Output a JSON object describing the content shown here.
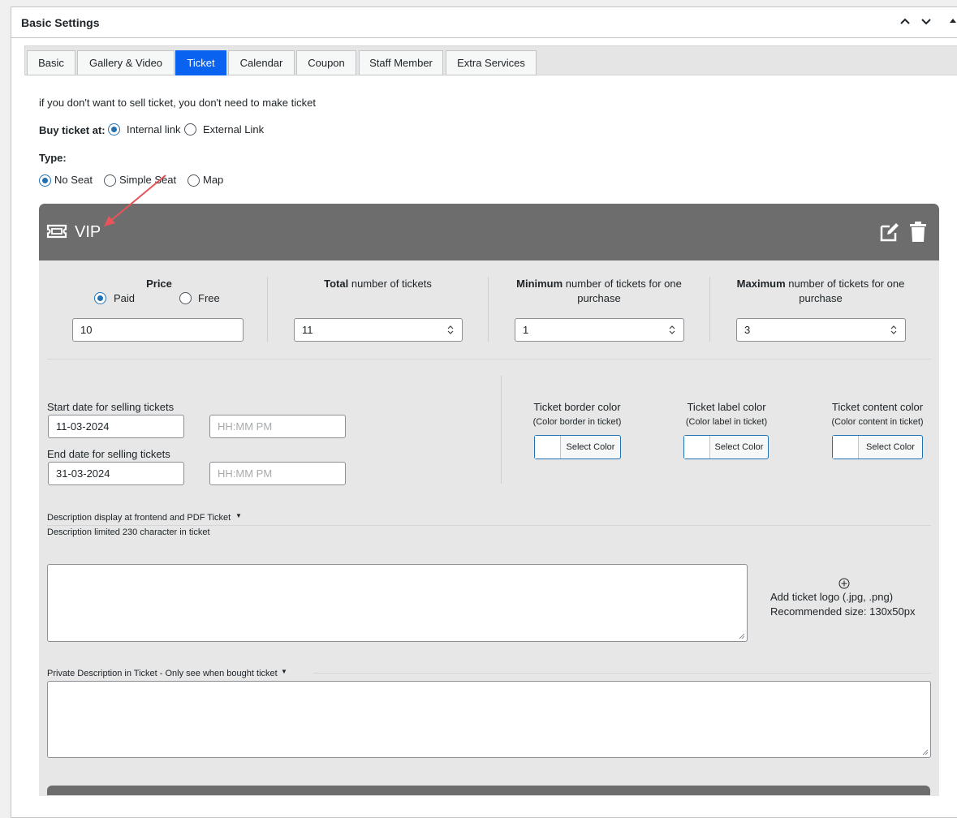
{
  "panel": {
    "title": "Basic Settings"
  },
  "tabs": [
    {
      "label": "Basic"
    },
    {
      "label": "Gallery & Video"
    },
    {
      "label": "Ticket"
    },
    {
      "label": "Calendar"
    },
    {
      "label": "Coupon"
    },
    {
      "label": "Staff Member"
    },
    {
      "label": "Extra Services"
    }
  ],
  "notice": "if you don't want to sell ticket, you don't need to make ticket",
  "buy_ticket": {
    "label": "Buy ticket at:",
    "options": [
      "Internal link",
      "External Link"
    ],
    "selected": "Internal link"
  },
  "type": {
    "label": "Type:",
    "options": [
      "No Seat",
      "Simple Seat",
      "Map"
    ],
    "selected": "No Seat"
  },
  "ticket": {
    "name": "VIP",
    "price": {
      "label": "Price",
      "options": [
        "Paid",
        "Free"
      ],
      "selected": "Paid",
      "value": "10"
    },
    "total": {
      "bold": "Total",
      "rest": " number of tickets",
      "value": "11"
    },
    "minimum": {
      "bold": "Minimum",
      "rest": " number of tickets for one purchase",
      "value": "1"
    },
    "maximum": {
      "bold": "Maximum",
      "rest": " number of tickets for one purchase",
      "value": "3"
    },
    "start_date": {
      "label": "Start date for selling tickets",
      "value": "11-03-2024",
      "time_placeholder": "HH:MM PM"
    },
    "end_date": {
      "label": "End date for selling tickets",
      "value": "31-03-2024",
      "time_placeholder": "HH:MM PM"
    },
    "colors": [
      {
        "title": "Ticket border color",
        "sub": "(Color border in ticket)",
        "button": "Select Color"
      },
      {
        "title": "Ticket label color",
        "sub": "(Color label in ticket)",
        "button": "Select Color"
      },
      {
        "title": "Ticket content color",
        "sub": "(Color content in ticket)",
        "button": "Select Color"
      }
    ],
    "description": {
      "label": "Description display at frontend and PDF Ticket",
      "hint": "Description limited 230 character in ticket"
    },
    "logo": {
      "line1": "Add ticket logo (.jpg, .png)",
      "line2": "Recommended size: 130x50px"
    },
    "private_description": {
      "label": "Private Description in Ticket - Only see when bought ticket"
    }
  },
  "colors": {
    "tab_active": "#0a63f0",
    "ticket_header": "#6d6d6d",
    "ticket_body": "#e7e7e7",
    "radio_checked": "#2271b1",
    "annotation_arrow": "#e8545a"
  }
}
